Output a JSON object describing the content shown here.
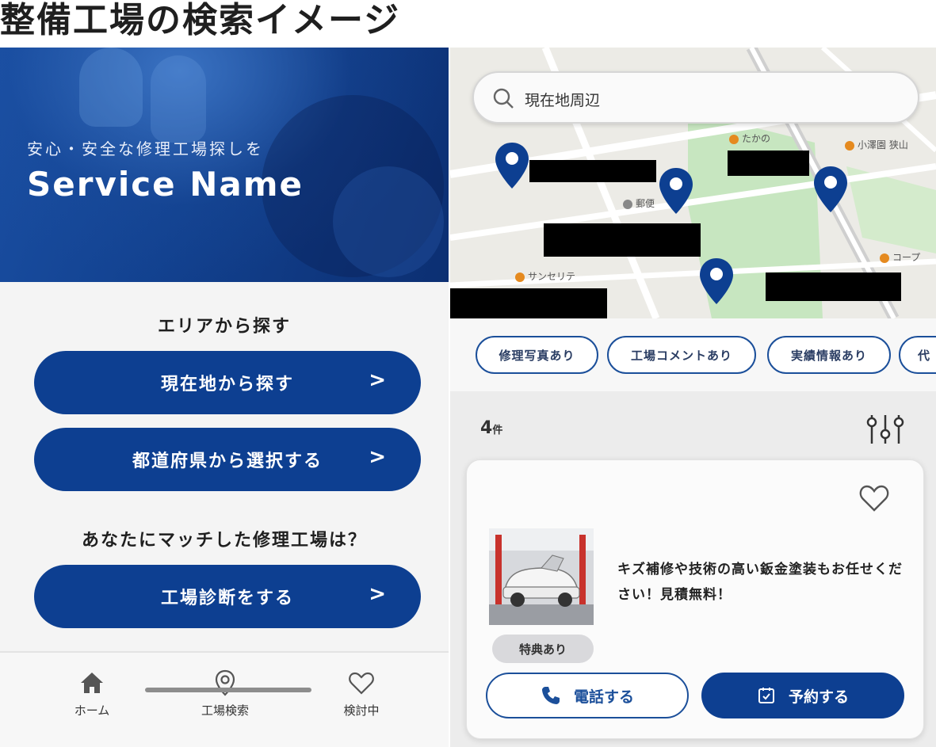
{
  "page_title": "整備工場の検索イメージ",
  "left": {
    "hero": {
      "tagline": "安心・安全な修理工場探しを",
      "service_name": "Service Name"
    },
    "area_heading": "エリアから探す",
    "btn_current_location": "現在地から探す",
    "btn_prefecture": "都道府県から選択する",
    "match_heading": "あなたにマッチした修理工場は？",
    "btn_diagnosis": "工場診断をする",
    "chevron": ">",
    "tabs": [
      {
        "label": "ホーム",
        "icon": "home-icon"
      },
      {
        "label": "工場検索",
        "icon": "map-pin-icon"
      },
      {
        "label": "検討中",
        "icon": "heart-icon"
      }
    ]
  },
  "right": {
    "search_placeholder": "現在地周辺",
    "map_pois": [
      "たかの",
      "小澤園 狭山",
      "郵便",
      "コープ",
      "サンセリテ"
    ],
    "chips": [
      "修理写真あり",
      "工場コメントあり",
      "実績情報あり",
      "代"
    ],
    "result_count": "4",
    "result_unit": "件",
    "card": {
      "description": "キズ補修や技術の高い鈑金塗装もお任せください！見積無料！",
      "badge": "特典あり",
      "call_label": "電話する",
      "book_label": "予約する"
    }
  },
  "colors": {
    "primary": "#0d3f91",
    "accent_outline": "#1b4f9a",
    "map_green": "#c7e6c0"
  }
}
